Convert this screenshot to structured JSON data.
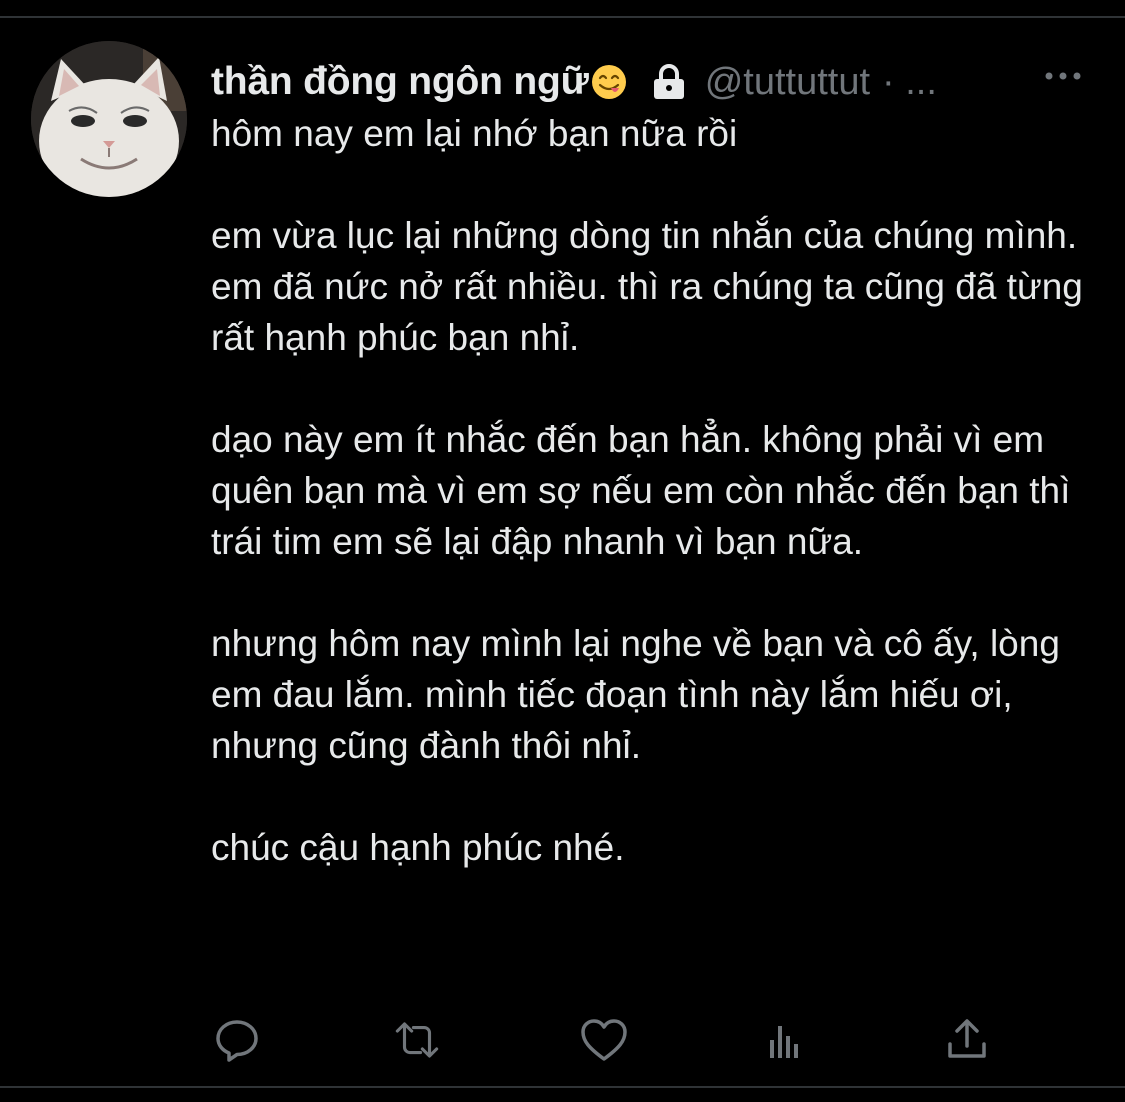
{
  "tweet": {
    "display_name": "thần đồng ngôn ngữ",
    "handle": "@tuttuttut",
    "meta": "· ...",
    "body": "hôm nay em lại nhớ bạn nữa rồi\n\nem vừa lục lại những dòng tin nhắn của chúng mình. em đã nức nở rất nhiều. thì ra chúng ta cũng đã từng rất hạnh phúc bạn nhỉ.\n\ndạo này em ít nhắc đến bạn hẳn. không phải vì em quên bạn mà vì em sợ nếu em còn nhắc đến bạn thì trái tim em sẽ lại đập nhanh vì bạn nữa.\n\nnhưng hôm nay mình lại nghe về bạn và cô ấy, lòng em đau lắm. mình tiếc đoạn tình này lắm hiếu ơi, nhưng cũng đành thôi nhỉ.\n\nchúc cậu hạnh phúc nhé."
  },
  "icons": {
    "avatar": "cat-avatar",
    "emoji": "yum-face-emoji",
    "lock": "lock-icon",
    "more": "more-icon",
    "reply": "reply-icon",
    "retweet": "retweet-icon",
    "like": "heart-icon",
    "views": "views-icon",
    "share": "share-icon"
  },
  "colors": {
    "background": "#000000",
    "text": "#e7e9ea",
    "secondary": "#71767b",
    "divider": "#2f3336"
  }
}
